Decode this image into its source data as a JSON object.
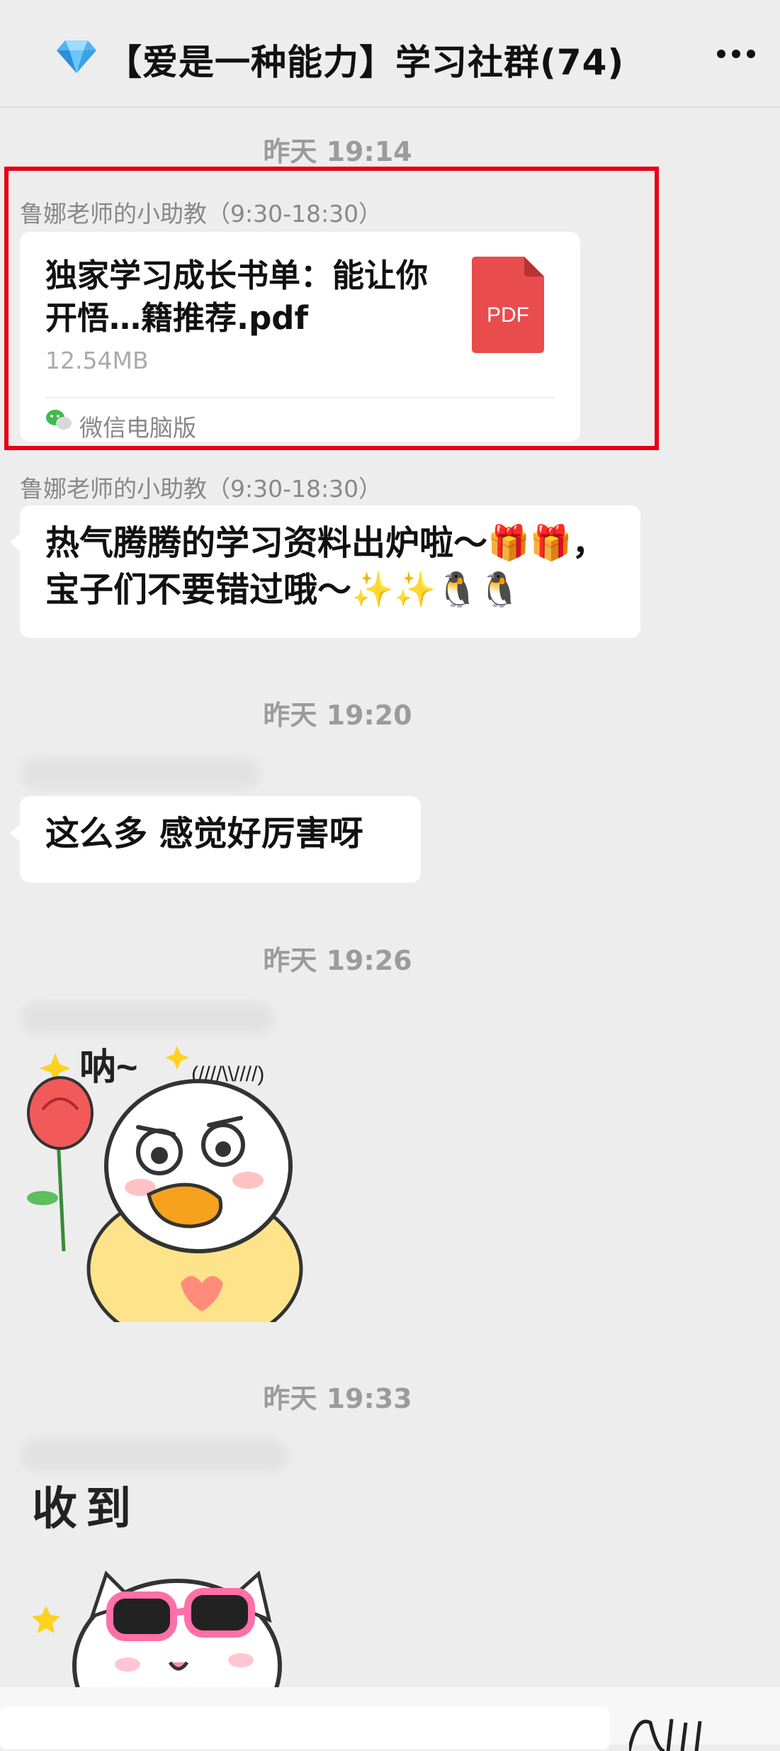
{
  "header": {
    "icon": "diamond-icon",
    "title": "【爱是一种能力】学习社群(74)",
    "more": "more-icon"
  },
  "messages": [
    {
      "time": "昨天 19:14"
    },
    {
      "sender": "鲁娜老师的小助教（9:30-18:30）",
      "file": {
        "name": "独家学习成长书单：能让你开悟…籍推荐.pdf",
        "size": "12.54MB",
        "icon_label": "PDF",
        "source": "微信电脑版"
      }
    },
    {
      "sender": "鲁娜老师的小助教（9:30-18:30）",
      "text": "热气腾腾的学习资料出炉啦～🎁🎁，宝子们不要错过哦～✨✨🐧🐧"
    },
    {
      "time": "昨天 19:20"
    },
    {
      "text": "这么多  感觉好厉害呀"
    },
    {
      "time": "昨天 19:26"
    },
    {
      "sticker_text": "呐~"
    },
    {
      "time": "昨天 19:33"
    },
    {
      "sticker_text": "收到"
    }
  ],
  "colors": {
    "background": "#ededed",
    "bubble": "#ffffff",
    "highlight": "#e60012",
    "pdf": "#e84c4c"
  }
}
